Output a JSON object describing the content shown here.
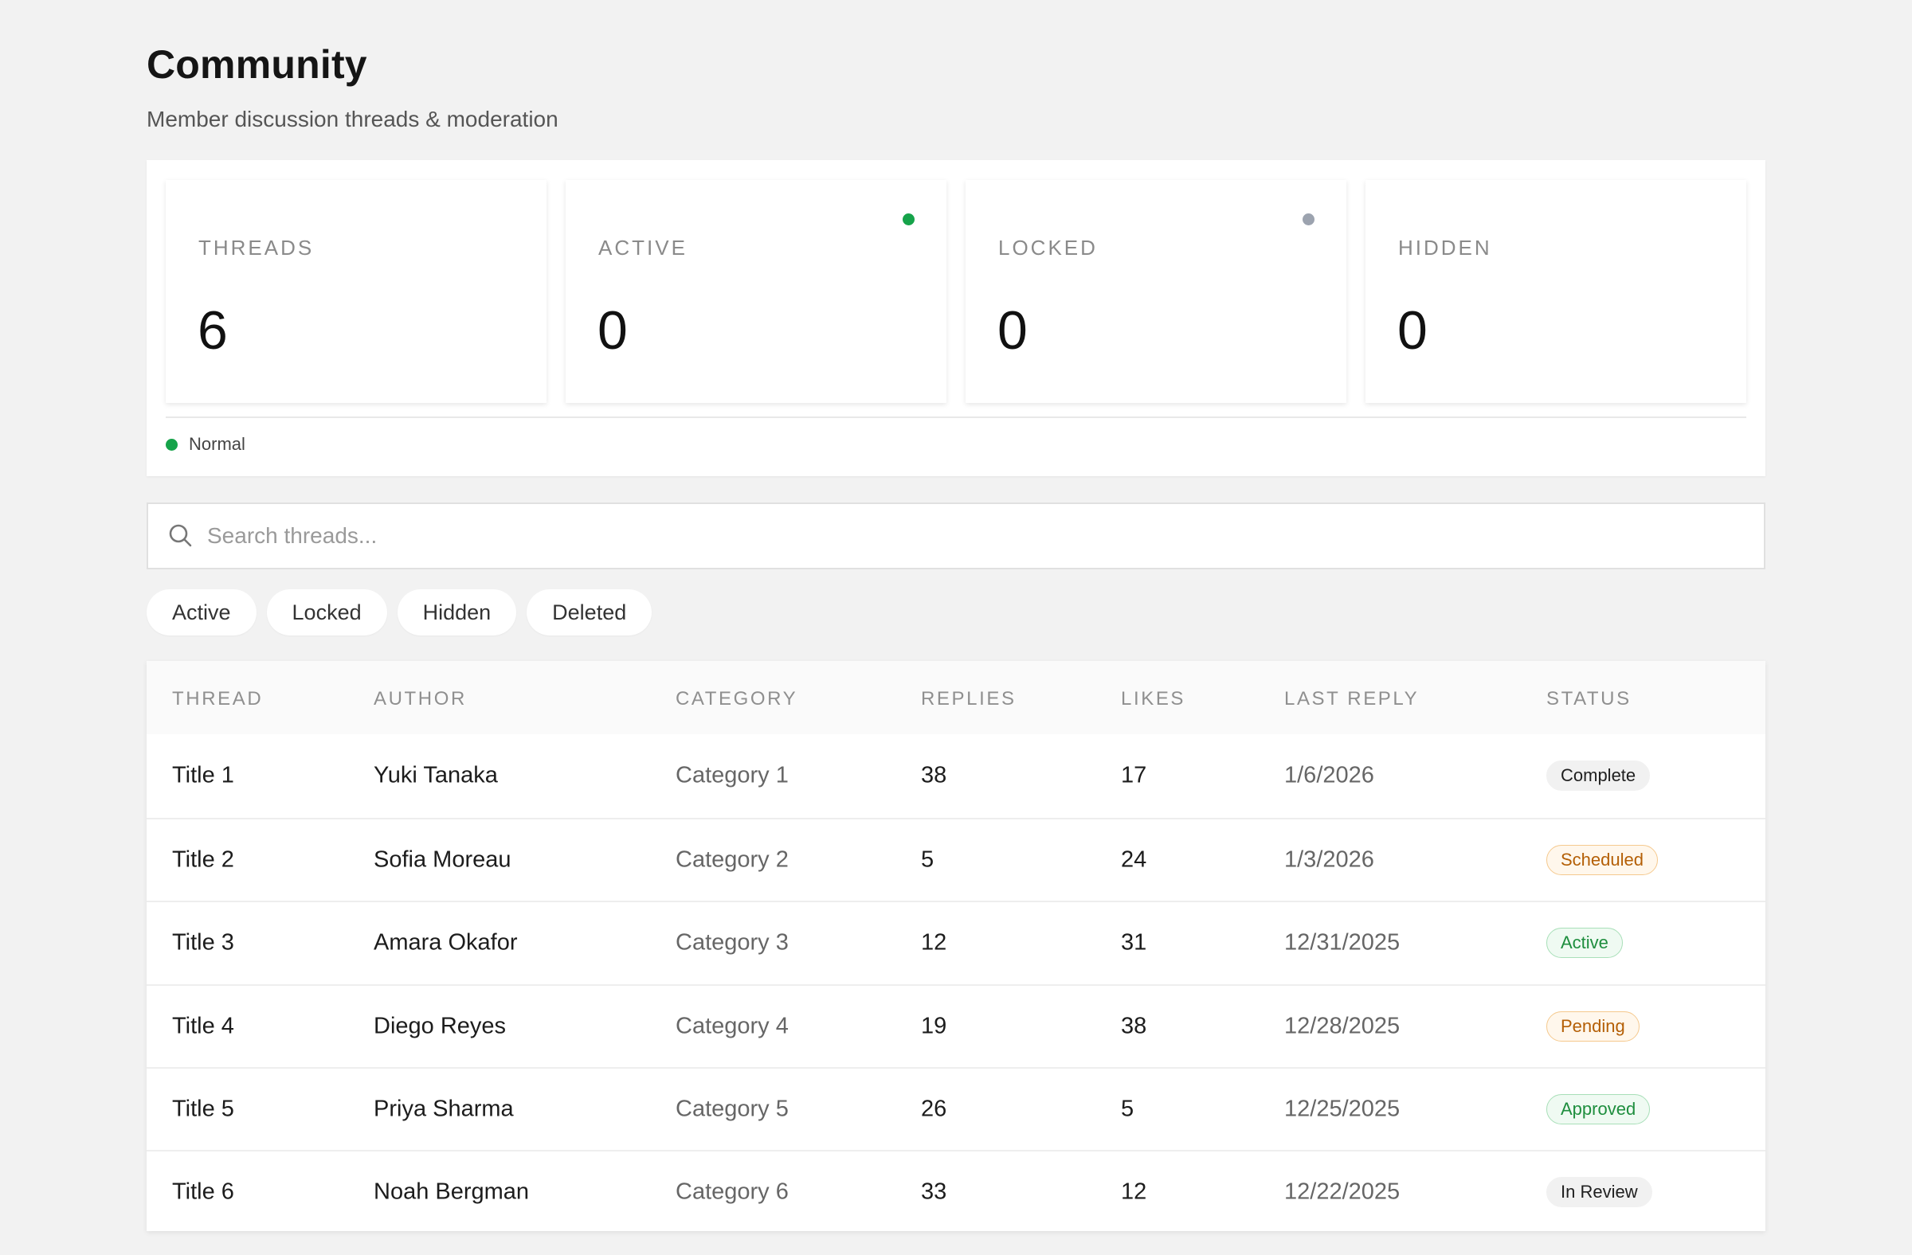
{
  "header": {
    "title": "Community",
    "subtitle": "Member discussion threads & moderation"
  },
  "stats": [
    {
      "label": "THREADS",
      "value": "6",
      "indicator": null
    },
    {
      "label": "ACTIVE",
      "value": "0",
      "indicator": "#16a34a"
    },
    {
      "label": "LOCKED",
      "value": "0",
      "indicator": "#9ca3af"
    },
    {
      "label": "HIDDEN",
      "value": "0",
      "indicator": null
    }
  ],
  "legend": {
    "label": "Normal",
    "color": "#16a34a"
  },
  "search": {
    "placeholder": "Search threads...",
    "value": ""
  },
  "filters": [
    "Active",
    "Locked",
    "Hidden",
    "Deleted"
  ],
  "table": {
    "columns": [
      "THREAD",
      "AUTHOR",
      "CATEGORY",
      "REPLIES",
      "LIKES",
      "LAST REPLY",
      "STATUS"
    ],
    "rows": [
      {
        "thread": "Title 1",
        "author": "Yuki Tanaka",
        "category": "Category 1",
        "replies": "38",
        "likes": "17",
        "last_reply": "1/6/2026",
        "status": "Complete",
        "status_tone": "neutral"
      },
      {
        "thread": "Title 2",
        "author": "Sofia Moreau",
        "category": "Category 2",
        "replies": "5",
        "likes": "24",
        "last_reply": "1/3/2026",
        "status": "Scheduled",
        "status_tone": "orange"
      },
      {
        "thread": "Title 3",
        "author": "Amara Okafor",
        "category": "Category 3",
        "replies": "12",
        "likes": "31",
        "last_reply": "12/31/2025",
        "status": "Active",
        "status_tone": "green"
      },
      {
        "thread": "Title 4",
        "author": "Diego Reyes",
        "category": "Category 4",
        "replies": "19",
        "likes": "38",
        "last_reply": "12/28/2025",
        "status": "Pending",
        "status_tone": "orange"
      },
      {
        "thread": "Title 5",
        "author": "Priya Sharma",
        "category": "Category 5",
        "replies": "26",
        "likes": "5",
        "last_reply": "12/25/2025",
        "status": "Approved",
        "status_tone": "green"
      },
      {
        "thread": "Title 6",
        "author": "Noah Bergman",
        "category": "Category 6",
        "replies": "33",
        "likes": "12",
        "last_reply": "12/22/2025",
        "status": "In Review",
        "status_tone": "neutral"
      }
    ]
  }
}
